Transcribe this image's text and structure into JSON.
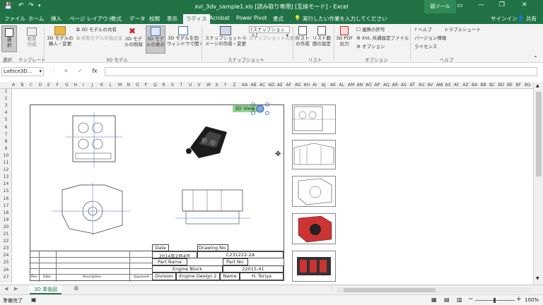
{
  "titlebar": {
    "title": "xvl_3dv_sample1.xls [読み取り専用] [互換モード] - Excel",
    "context_tab": "図ツール",
    "minimize": "—",
    "restore": "❐",
    "close": "✕"
  },
  "tabs": [
    "ファイル",
    "ホーム",
    "挿入",
    "ページ レイアウト",
    "数式",
    "データ",
    "校閲",
    "表示",
    "ラティス",
    "Acrobat",
    "Power Pivot",
    "書式"
  ],
  "tell_me": "実行したい作業を入力してください",
  "signin": "サインイン",
  "share": "共有",
  "ribbon": {
    "buttons": {
      "select": "選\n択",
      "large_draw": "帳票\n作成",
      "insert_model": "3D モデルの\n挿入・変更",
      "share_model": "3D モデルの共有",
      "share_standalone": "共有モデルの独立化",
      "delete_model": "3D モデ\nルの削除",
      "show_model": "3D モデ\nルの表示",
      "open_window": "3D モデルを別\nウィンドウで開く",
      "snapshot_create": "スナップショットイ\nメージの作成・変更",
      "snapshot_dropdown": "[スナップショット]",
      "snapshot_update": "スナップショットの更新",
      "list_create": "リスト\nの作成",
      "list_range": "リスト範\n囲の設定",
      "pdf_output": "3D PDF\n出力",
      "link_allow": "連携の許可",
      "xvl_common": "XVL 共通設定ファイル",
      "options": "オプション",
      "help": "ヘルプ",
      "version": "バージョン情報",
      "license": "ライセンス",
      "troubleshoot": "トラブルシュート"
    },
    "groups": {
      "select": "選択",
      "template": "テンプレート",
      "model": "3D モデル",
      "snapshot": "スナップショット",
      "list": "リスト",
      "option": "オプション",
      "help": "ヘルプ"
    }
  },
  "formula_bar": {
    "name_box": "Lattice3D...",
    "cancel": "✕",
    "enter": "✓",
    "fx": "fx",
    "value": ""
  },
  "columns": [
    "A",
    "B",
    "C",
    "D",
    "E",
    "F",
    "G",
    "H",
    "I",
    "J",
    "K",
    "L",
    "M",
    "N",
    "O",
    "P",
    "Q",
    "R",
    "S",
    "T",
    "U",
    "V",
    "W",
    "X",
    "Y",
    "Z",
    "AA",
    "AB",
    "AC",
    "AD",
    "AE",
    "AF",
    "AG",
    "AH",
    "AI",
    "AJ",
    "AK",
    "AL",
    "AM",
    "AN",
    "AO",
    "AP",
    "AQ",
    "AR",
    "AS",
    "AT",
    "AU",
    "AV",
    "AW",
    "AX",
    "AY",
    "AZ",
    "BA",
    "BB",
    "BC",
    "BD",
    "BE",
    "BF",
    "BG"
  ],
  "rows": [
    "1",
    "2",
    "3",
    "4",
    "5",
    "6",
    "7",
    "8",
    "9",
    "10",
    "11",
    "12",
    "13",
    "14",
    "15",
    "16",
    "17",
    "18",
    "19",
    "20",
    "21",
    "22",
    "23",
    "24",
    "25",
    "26",
    "27"
  ],
  "drawing": {
    "view_label": "3D View",
    "title_block": {
      "date_label": "Date",
      "date_value": "2014年2月4日",
      "drawing_no_label": "Drawing No.",
      "drawing_no_value": "C231222-2A",
      "part_name_label": "Part Name",
      "part_name_value": "Engine Block",
      "part_no_label": "Part No.",
      "part_no_value": "22015-41",
      "division_label": "Division",
      "division_value": "Engine Design 2",
      "name_label": "Name",
      "name_value": "H. Toriya",
      "rev_label": "Rev.",
      "rev_date_label": "Date",
      "description_label": "Description",
      "approved_label": "Approved"
    }
  },
  "sheet_tab": "3D 単独図",
  "status": {
    "ready": "準備完了",
    "zoom": "100%"
  },
  "colors": {
    "excel_green": "#217346",
    "view_label_bg": "#8fd88f"
  }
}
